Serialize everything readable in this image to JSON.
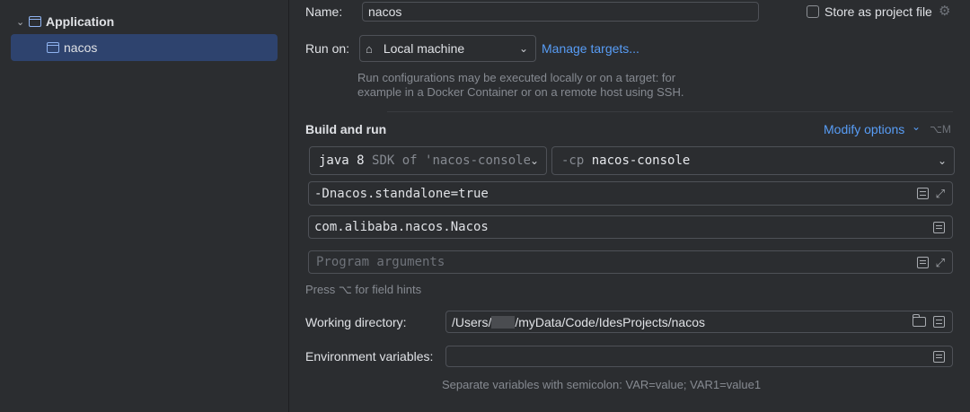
{
  "tree": {
    "group_label": "Application",
    "item_label": "nacos"
  },
  "form": {
    "name_label": "Name:",
    "name_value": "nacos",
    "store_label": "Store as project file",
    "run_on_label": "Run on:",
    "run_on_value": "Local machine",
    "manage_targets": "Manage targets...",
    "run_on_hint_1": "Run configurations may be executed locally or on a target: for",
    "run_on_hint_2": "example in a Docker Container or on a remote host using SSH.",
    "build_run_title": "Build and run",
    "modify_options": "Modify options",
    "modify_shortcut": "⌥M",
    "jdk_bold": "java 8",
    "jdk_hint": "SDK of 'nacos-console'",
    "cp_prefix": "-cp",
    "cp_value": "nacos-console",
    "vm_options": "-Dnacos.standalone=true",
    "main_class": "com.alibaba.nacos.Nacos",
    "program_args_placeholder": "Program arguments",
    "field_hints": "Press ⌥ for field hints",
    "workdir_label": "Working directory:",
    "workdir_prefix": "/Users/",
    "workdir_suffix": "/myData/Code/IdesProjects/nacos",
    "env_label": "Environment variables:",
    "env_value": "",
    "env_hint": "Separate variables with semicolon: VAR=value; VAR1=value1"
  }
}
